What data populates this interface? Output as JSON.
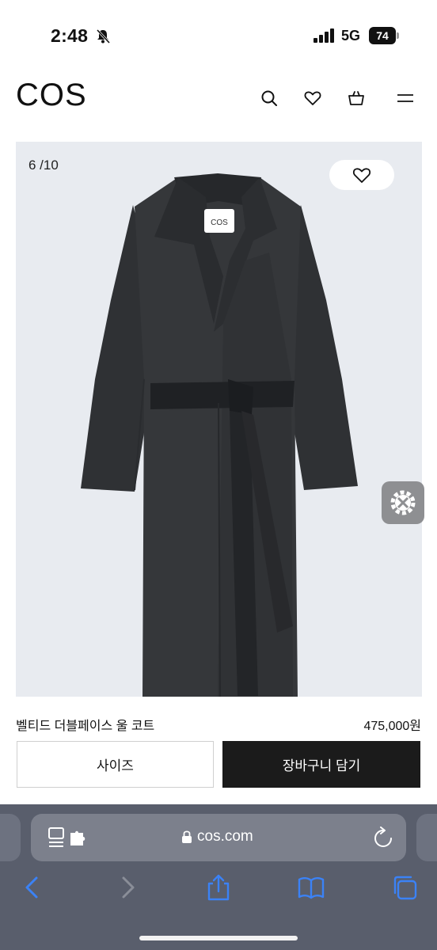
{
  "status": {
    "time": "2:48",
    "network": "5G",
    "battery": "74"
  },
  "header": {
    "logo": "COS",
    "icons": [
      "search-icon",
      "heart-icon",
      "shopping-bag-icon",
      "menu-icon"
    ]
  },
  "gallery": {
    "counter": "6 /10",
    "garment_label": "COS"
  },
  "product": {
    "name": "벨티드 더블페이스 울 코트",
    "price": "475,000원"
  },
  "actions": {
    "size_label": "사이즈",
    "cart_label": "장바구니 담기"
  },
  "browser": {
    "url": "cos.com",
    "icons": [
      "reader-extension-icon",
      "lock-icon",
      "reload-icon",
      "back-icon",
      "forward-icon",
      "share-icon",
      "bookmarks-icon",
      "tabs-icon"
    ]
  },
  "colors": {
    "accent": "#1b1b1b",
    "browser_chrome": "#595e6c",
    "link_blue": "#3b82f6"
  }
}
